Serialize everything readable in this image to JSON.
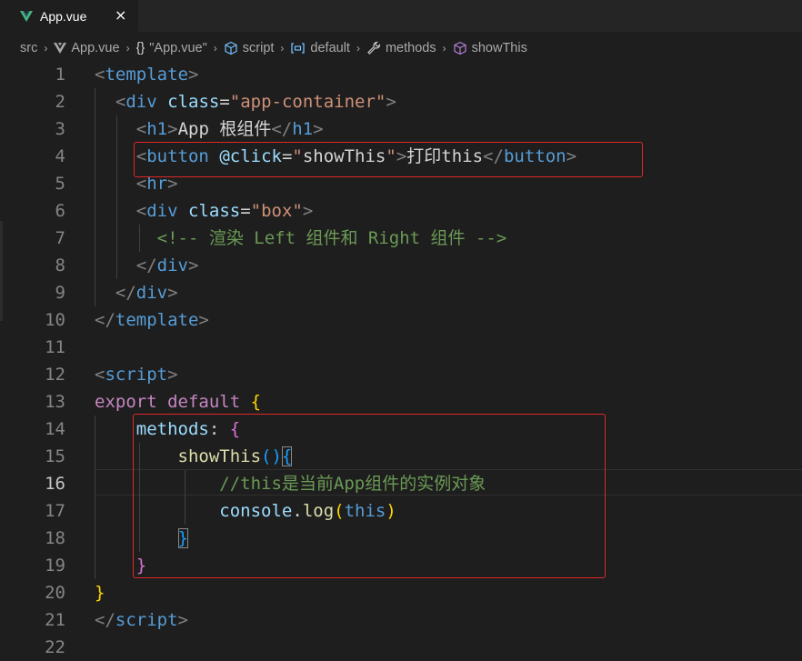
{
  "tab": {
    "title": "App.vue",
    "close": "×"
  },
  "breadcrumb": {
    "items": [
      {
        "label": "src"
      },
      {
        "label": "App.vue"
      },
      {
        "label": "\"App.vue\"",
        "prefix": "{}"
      },
      {
        "label": "script"
      },
      {
        "label": "default"
      },
      {
        "label": "methods"
      },
      {
        "label": "showThis"
      }
    ],
    "separator": "›"
  },
  "editor": {
    "active_line": 16,
    "lines": [
      {
        "n": "1",
        "tokens": [
          [
            "p",
            "<"
          ],
          [
            "tag",
            "template"
          ],
          [
            "p",
            ">"
          ]
        ]
      },
      {
        "n": "2",
        "tokens": [
          [
            "t",
            "  "
          ],
          [
            "p",
            "<"
          ],
          [
            "tag",
            "div"
          ],
          [
            "t",
            " "
          ],
          [
            "attr",
            "class"
          ],
          [
            "t",
            "="
          ],
          [
            "str",
            "\"app-container\""
          ],
          [
            "p",
            ">"
          ]
        ]
      },
      {
        "n": "3",
        "tokens": [
          [
            "t",
            "    "
          ],
          [
            "p",
            "<"
          ],
          [
            "tag",
            "h1"
          ],
          [
            "p",
            ">"
          ],
          [
            "t",
            "App 根组件"
          ],
          [
            "p",
            "</"
          ],
          [
            "tag",
            "h1"
          ],
          [
            "p",
            ">"
          ]
        ]
      },
      {
        "n": "4",
        "tokens": [
          [
            "t",
            "    "
          ],
          [
            "p",
            "<"
          ],
          [
            "tag",
            "button"
          ],
          [
            "t",
            " "
          ],
          [
            "attr",
            "@click"
          ],
          [
            "t",
            "="
          ],
          [
            "str2",
            "\""
          ],
          [
            "t",
            "showThis"
          ],
          [
            "str2",
            "\""
          ],
          [
            "p",
            ">"
          ],
          [
            "t",
            "打印this"
          ],
          [
            "p",
            "</"
          ],
          [
            "tag",
            "button"
          ],
          [
            "p",
            ">"
          ]
        ]
      },
      {
        "n": "5",
        "tokens": [
          [
            "t",
            "    "
          ],
          [
            "p",
            "<"
          ],
          [
            "tag",
            "hr"
          ],
          [
            "p",
            ">"
          ]
        ]
      },
      {
        "n": "6",
        "tokens": [
          [
            "t",
            "    "
          ],
          [
            "p",
            "<"
          ],
          [
            "tag",
            "div"
          ],
          [
            "t",
            " "
          ],
          [
            "attr",
            "class"
          ],
          [
            "t",
            "="
          ],
          [
            "str",
            "\"box\""
          ],
          [
            "p",
            ">"
          ]
        ]
      },
      {
        "n": "7",
        "tokens": [
          [
            "t",
            "      "
          ],
          [
            "c",
            "<!-- 渲染 Left 组件和 Right 组件 -->"
          ]
        ]
      },
      {
        "n": "8",
        "tokens": [
          [
            "t",
            "    "
          ],
          [
            "p",
            "</"
          ],
          [
            "tag",
            "div"
          ],
          [
            "p",
            ">"
          ]
        ]
      },
      {
        "n": "9",
        "tokens": [
          [
            "t",
            "  "
          ],
          [
            "p",
            "</"
          ],
          [
            "tag",
            "div"
          ],
          [
            "p",
            ">"
          ]
        ]
      },
      {
        "n": "10",
        "tokens": [
          [
            "p",
            "</"
          ],
          [
            "tag",
            "template"
          ],
          [
            "p",
            ">"
          ]
        ]
      },
      {
        "n": "11",
        "tokens": []
      },
      {
        "n": "12",
        "tokens": [
          [
            "p",
            "<"
          ],
          [
            "tag",
            "script"
          ],
          [
            "p",
            ">"
          ]
        ]
      },
      {
        "n": "13",
        "tokens": [
          [
            "kw",
            "export"
          ],
          [
            "t",
            " "
          ],
          [
            "kw",
            "default"
          ],
          [
            "t",
            " "
          ],
          [
            "b1",
            "{"
          ]
        ]
      },
      {
        "n": "14",
        "tokens": [
          [
            "t",
            "    "
          ],
          [
            "prop",
            "methods"
          ],
          [
            "t",
            ": "
          ],
          [
            "b2",
            "{"
          ]
        ]
      },
      {
        "n": "15",
        "tokens": [
          [
            "t",
            "        "
          ],
          [
            "fn",
            "showThis"
          ],
          [
            "b3",
            "()"
          ],
          [
            "b3m",
            "{"
          ]
        ]
      },
      {
        "n": "16",
        "tokens": [
          [
            "t",
            "            "
          ],
          [
            "c",
            "//this是当前App组件的实例对象"
          ]
        ]
      },
      {
        "n": "17",
        "tokens": [
          [
            "t",
            "            "
          ],
          [
            "prop",
            "console"
          ],
          [
            "t",
            "."
          ],
          [
            "fn",
            "log"
          ],
          [
            "b1",
            "("
          ],
          [
            "this",
            "this"
          ],
          [
            "b1",
            ")"
          ]
        ]
      },
      {
        "n": "18",
        "tokens": [
          [
            "t",
            "        "
          ],
          [
            "b3m",
            "}"
          ]
        ]
      },
      {
        "n": "19",
        "tokens": [
          [
            "t",
            "    "
          ],
          [
            "b2",
            "}"
          ]
        ]
      },
      {
        "n": "20",
        "tokens": [
          [
            "b1",
            "}"
          ]
        ]
      },
      {
        "n": "21",
        "tokens": [
          [
            "p",
            "</"
          ],
          [
            "tag",
            "script"
          ],
          [
            "p",
            ">"
          ]
        ]
      },
      {
        "n": "22",
        "tokens": []
      }
    ]
  },
  "colors": {
    "background": "#1e1e1e",
    "highlight_box": "#e02828",
    "tag": "#569cd6",
    "attribute": "#9cdcfe",
    "string": "#ce9178",
    "comment": "#6a9955",
    "keyword": "#c586c0",
    "function": "#dcdcaa"
  },
  "icons": {
    "tab": "vue-icon",
    "breadcrumb": [
      "",
      "vue-icon",
      "json-braces-icon",
      "cube-icon",
      "variable-icon",
      "wrench-icon",
      "cube-icon"
    ]
  }
}
